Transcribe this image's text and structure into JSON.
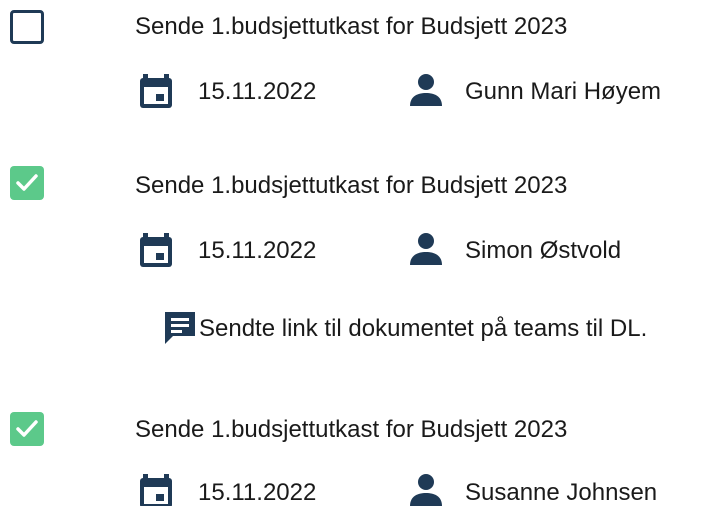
{
  "colors": {
    "navy": "#1f3a56",
    "checked_green": "#5cc98a"
  },
  "tasks": [
    {
      "checked": false,
      "title": "Sende 1.budsjettutkast for Budsjett 2023",
      "date": "15.11.2022",
      "assignee": "Gunn Mari Høyem",
      "comment": null
    },
    {
      "checked": true,
      "title": "Sende 1.budsjettutkast for Budsjett 2023",
      "date": "15.11.2022",
      "assignee": "Simon Østvold",
      "comment": "Sendte link til dokumentet på teams til DL."
    },
    {
      "checked": true,
      "title": "Sende 1.budsjettutkast for Budsjett 2023",
      "date": "15.11.2022",
      "assignee": "Susanne Johnsen",
      "comment": null
    }
  ]
}
